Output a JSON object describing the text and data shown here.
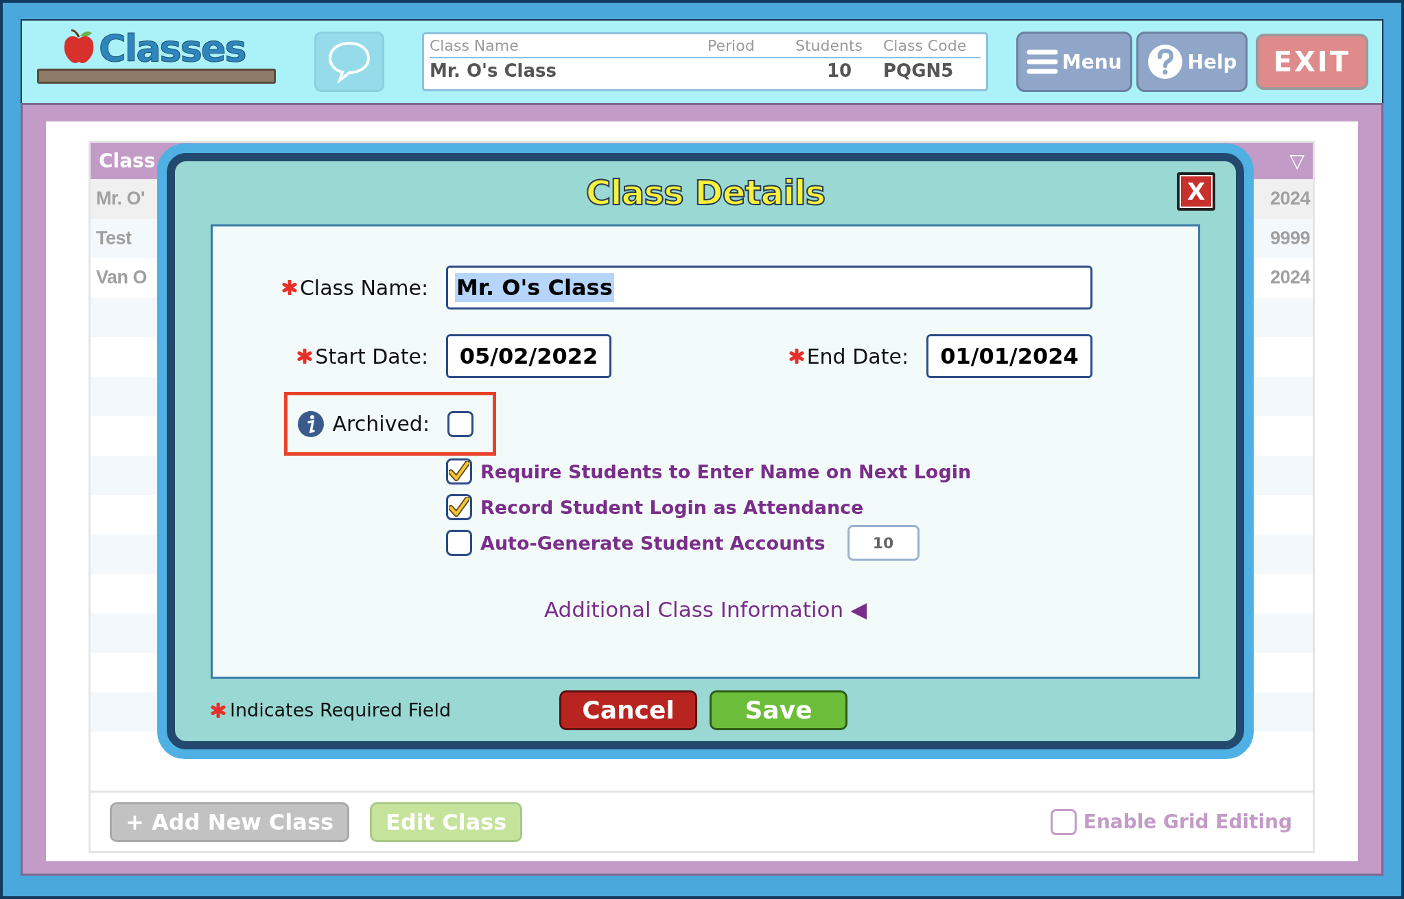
{
  "header": {
    "logo": "Classes",
    "class_summary": {
      "columns": [
        "Class Name",
        "Period",
        "Students",
        "Class Code"
      ],
      "row": {
        "class_name": "Mr. O's Class",
        "students": "10",
        "class_code": "PQGN5"
      }
    },
    "buttons": [
      {
        "kind": "menu",
        "label": "Menu"
      },
      {
        "kind": "help",
        "label": "Help"
      },
      {
        "kind": "exit",
        "label": "EXIT"
      }
    ]
  },
  "class_list": {
    "header": {
      "column_1": "Class",
      "sort_indicator": "▽"
    },
    "rows": [
      {
        "column_1": "Mr. O'",
        "column_last": "2024",
        "selected": true
      },
      {
        "column_1": "Test",
        "column_last": "9999",
        "selected": false
      },
      {
        "column_1": "Van O",
        "column_last": "2024",
        "selected": false
      }
    ],
    "add_button": "+ Add New Class",
    "edit_button": "Edit Class",
    "grid_editing": {
      "label": "Enable Grid Editing",
      "checked": false
    }
  },
  "dialog": {
    "title": "Class Details",
    "close": "X",
    "class_name": {
      "label": "Class Name:",
      "value": "Mr. O's Class",
      "required": true,
      "text_selected": true
    },
    "start_date": {
      "label": "Start Date:",
      "value": "05/02/2022",
      "required": true
    },
    "end_date": {
      "label": "End Date:",
      "value": "01/01/2024",
      "required": true
    },
    "archived": {
      "label": "Archived:",
      "checked": false,
      "highlighted": true
    },
    "options": [
      {
        "label": "Require Students to Enter Name on Next Login",
        "checked": true
      },
      {
        "label": "Record Student Login as Attendance",
        "checked": true
      },
      {
        "label": "Auto-Generate Student Accounts",
        "checked": false,
        "count": "10"
      }
    ],
    "more_link": {
      "label": "Additional Class Information",
      "indicator": "◀"
    },
    "required_note": "Indicates Required Field",
    "buttons": [
      {
        "kind": "cancel",
        "label": "Cancel"
      },
      {
        "kind": "save",
        "label": "Save"
      }
    ]
  }
}
